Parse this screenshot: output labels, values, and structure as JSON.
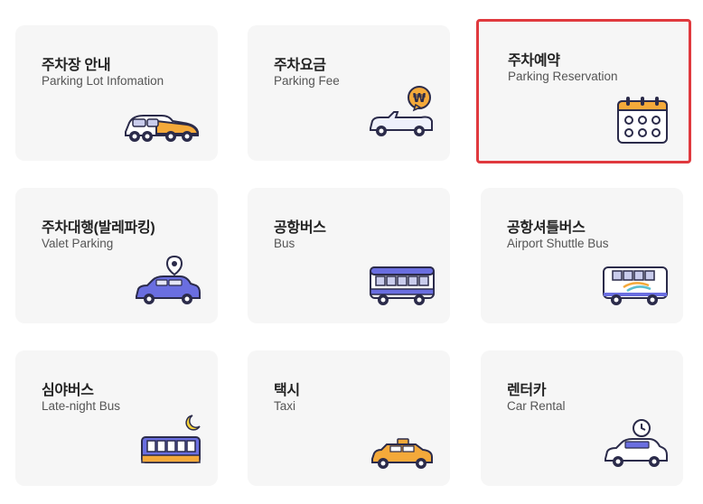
{
  "cards": [
    {
      "title": "주차장 안내",
      "subtitle": "Parking Lot Infomation",
      "icon": "car-icon"
    },
    {
      "title": "주차요금",
      "subtitle": "Parking Fee",
      "icon": "convertible-won-icon"
    },
    {
      "title": "주차예약",
      "subtitle": "Parking Reservation",
      "icon": "calendar-icon",
      "selected": true
    },
    {
      "title": "주차대행(발레파킹)",
      "subtitle": "Valet Parking",
      "icon": "valet-car-pin-icon"
    },
    {
      "title": "공항버스",
      "subtitle": "Bus",
      "icon": "bus-icon"
    },
    {
      "title": "공항셔틀버스",
      "subtitle": "Airport Shuttle Bus",
      "icon": "shuttle-bus-icon"
    },
    {
      "title": "심야버스",
      "subtitle": "Late-night Bus",
      "icon": "night-bus-icon"
    },
    {
      "title": "택시",
      "subtitle": "Taxi",
      "icon": "taxi-icon"
    },
    {
      "title": "렌터카",
      "subtitle": "Car Rental",
      "icon": "rental-car-clock-icon"
    }
  ],
  "colors": {
    "selected_border": "#e0393e",
    "card_bg": "#f6f6f6",
    "accent_orange": "#f4a93a",
    "accent_blue": "#6a6ee0",
    "outline": "#2b2b4a"
  }
}
